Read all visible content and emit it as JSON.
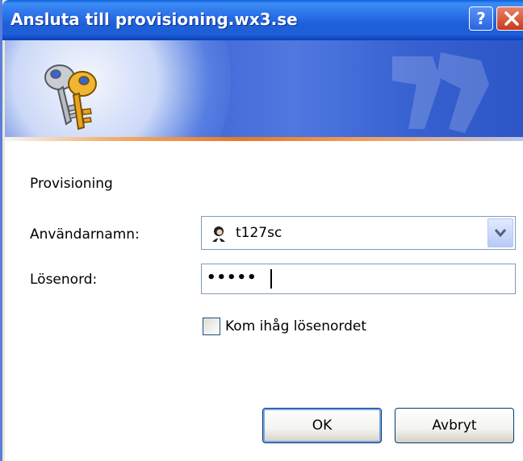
{
  "window": {
    "title": "Ansluta till provisioning.wx3.se",
    "help_symbol": "?"
  },
  "form": {
    "realm": "Provisioning",
    "username_label": "Användarnamn:",
    "username_value": "t127sc",
    "password_label": "Lösenord:",
    "password_masked": "•••••",
    "remember_label": "Kom ihåg lösenordet",
    "remember_checked": false
  },
  "buttons": {
    "ok_label": "OK",
    "cancel_label": "Avbryt"
  },
  "colors": {
    "titlebar": "#1d5fd9",
    "banner": "#3a63d3",
    "close": "#c8391b"
  },
  "icons": {
    "banner": "keys-icon",
    "user": "user-icon",
    "dropdown": "chevron-down-icon",
    "close": "close-icon",
    "help": "help-icon"
  }
}
